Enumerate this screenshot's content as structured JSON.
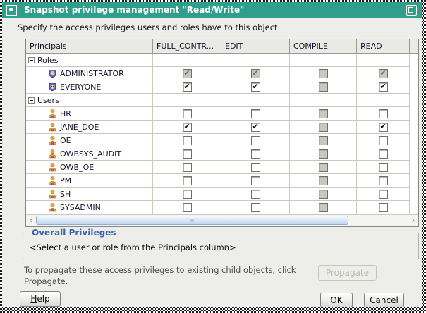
{
  "window": {
    "title": "Snapshot privilege management \"Read/Write\""
  },
  "instruction": "Specify the access privileges users and roles have to this object.",
  "privileges_table": {
    "columns": [
      "Principals",
      "FULL_CONTR...",
      "EDIT",
      "COMPILE",
      "READ"
    ],
    "rows": [
      {
        "type": "group",
        "label": "Roles",
        "expanded": true
      },
      {
        "type": "member",
        "label": "ADMINISTRATOR",
        "icon": "role-icon",
        "privileges": [
          "on-dim",
          "on-dim",
          "off-dim",
          "on-dim"
        ]
      },
      {
        "type": "member",
        "label": "EVERYONE",
        "icon": "role-icon",
        "privileges": [
          "on",
          "on",
          "off-dim",
          "on"
        ]
      },
      {
        "type": "group",
        "label": "Users",
        "expanded": true
      },
      {
        "type": "member",
        "label": "HR",
        "icon": "user-icon",
        "privileges": [
          "off",
          "off",
          "off-dim",
          "off"
        ]
      },
      {
        "type": "member",
        "label": "JANE_DOE",
        "icon": "user-icon",
        "privileges": [
          "on",
          "on",
          "off-dim",
          "on"
        ]
      },
      {
        "type": "member",
        "label": "OE",
        "icon": "user-icon",
        "privileges": [
          "off",
          "off",
          "off-dim",
          "off"
        ]
      },
      {
        "type": "member",
        "label": "OWBSYS_AUDIT",
        "icon": "user-icon",
        "privileges": [
          "off",
          "off",
          "off-dim",
          "off"
        ]
      },
      {
        "type": "member",
        "label": "OWB_OE",
        "icon": "user-icon",
        "privileges": [
          "off",
          "off",
          "off-dim",
          "off"
        ]
      },
      {
        "type": "member",
        "label": "PM",
        "icon": "user-icon",
        "privileges": [
          "off",
          "off",
          "off-dim",
          "off"
        ]
      },
      {
        "type": "member",
        "label": "SH",
        "icon": "user-icon",
        "privileges": [
          "off",
          "off",
          "off-dim",
          "off"
        ]
      },
      {
        "type": "member",
        "label": "SYSADMIN",
        "icon": "user-icon",
        "privileges": [
          "off",
          "off",
          "off-dim",
          "off"
        ]
      }
    ],
    "h_scrollbar": {
      "left_arrow": "‹",
      "right_arrow": "›"
    }
  },
  "overall_privileges": {
    "title": "Overall Privileges",
    "message": "<Select a user or role from the Principals column>"
  },
  "footer": {
    "note_lines": [
      "To propagate these access privileges to existing child objects, click",
      "Propagate."
    ],
    "propagate_label": "Propagate",
    "help_label": "Help",
    "ok_label": "OK",
    "cancel_label": "Cancel"
  },
  "colors": {
    "titlebar": "#2F9E8A",
    "legend_blue": "#3A66B5",
    "disabled_checkbox_bg": "#C8C8C3"
  }
}
